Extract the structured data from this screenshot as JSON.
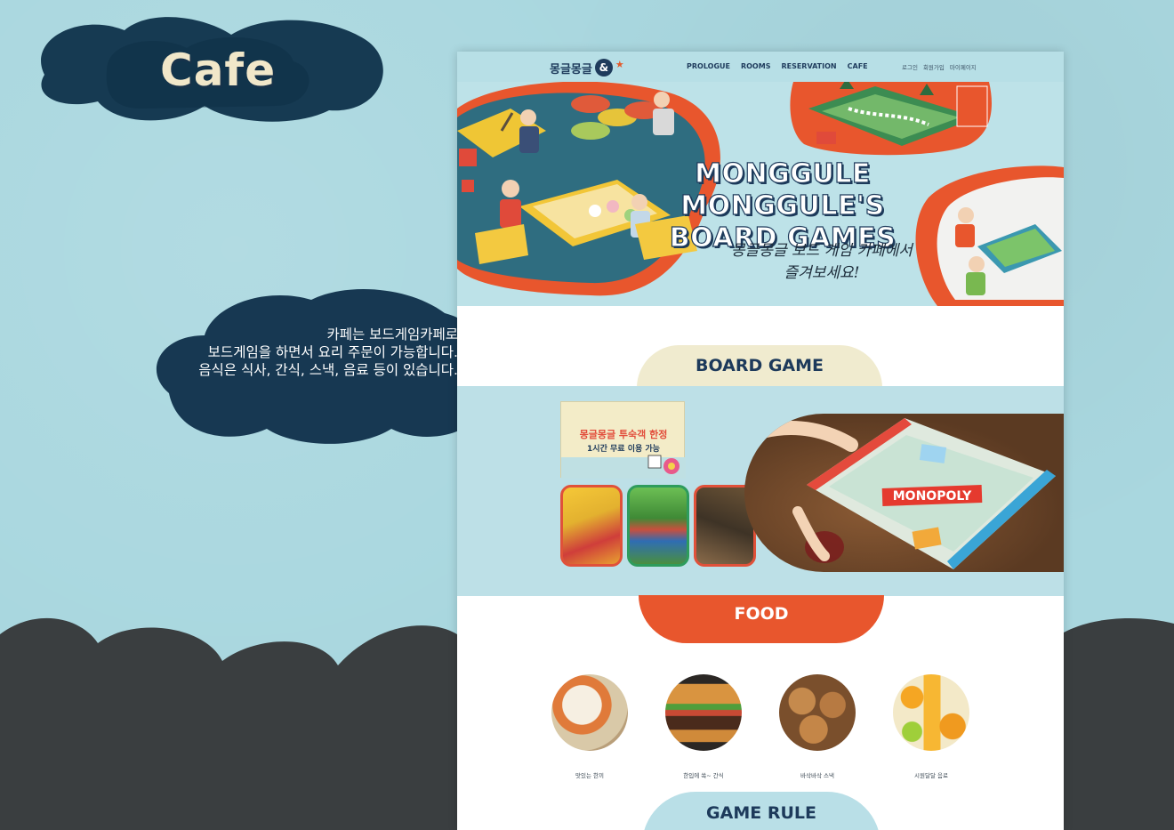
{
  "showcase": {
    "title": "Cafe",
    "description": [
      "카페는 보드게임카페로",
      "보드게임을 하면서 요리 주문이 가능합니다.",
      "음식은 식사, 간식, 스낵, 음료 등이 있습니다."
    ]
  },
  "nav": {
    "logo": "몽글몽글",
    "logo_mark": "&",
    "menu": [
      "PROLOGUE",
      "ROOMS",
      "RESERVATION",
      "CAFE"
    ],
    "util": [
      "로그인",
      "회원가입",
      "마이페이지"
    ]
  },
  "hero": {
    "title_line1": "MONGGULE MONGGULE'S",
    "title_line2": "BOARD GAMES",
    "sub_line1": "몽글몽글 보드 게임 카페에서",
    "sub_line2": "즐겨보세요!"
  },
  "board_game": {
    "heading": "BOARD GAME",
    "promo_line1": "몽글몽글 투숙객 한정",
    "promo_line2": "1시간 무료 이용 가능",
    "photo_label": "MONOPOLY"
  },
  "food": {
    "heading": "FOOD",
    "items": [
      {
        "label": "맛있는 한끼"
      },
      {
        "label": "한입에 쏙~ 간식"
      },
      {
        "label": "바삭바삭 스낵"
      },
      {
        "label": "시원달달 음료"
      }
    ]
  },
  "game_rule": {
    "heading": "GAME RULE"
  },
  "colors": {
    "background": "#a9d7df",
    "navy": "#1d3a5b",
    "orange": "#e8562d",
    "cream": "#f0ebcf",
    "dark_cloud": "#3a3e40"
  }
}
